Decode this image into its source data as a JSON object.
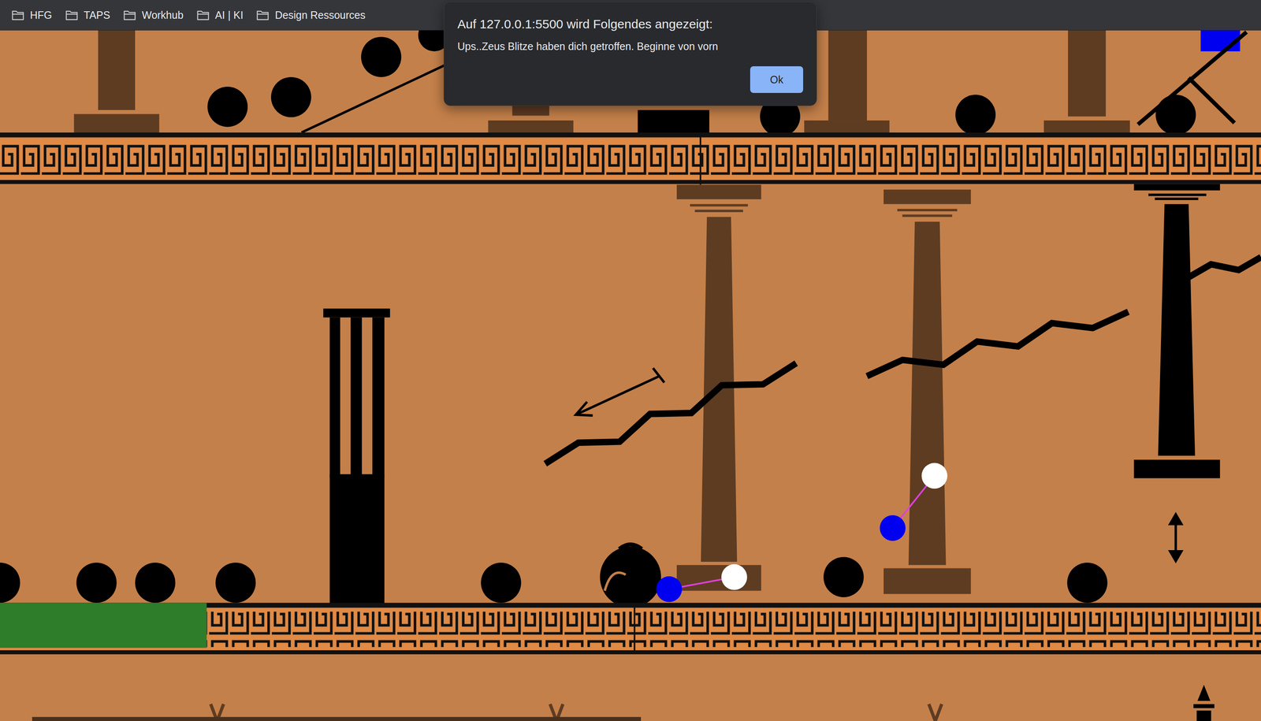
{
  "browser": {
    "bookmarks": [
      {
        "label": "HFG"
      },
      {
        "label": "TAPS"
      },
      {
        "label": "Workhub"
      },
      {
        "label": "AI | KI"
      },
      {
        "label": "Design Ressources"
      }
    ]
  },
  "dialog": {
    "title": "Auf 127.0.0.1:5500 wird Folgendes angezeigt:",
    "message": "Ups..Zeus Blitze haben dich getroffen. Beginne von vorn",
    "button": "Ok"
  }
}
